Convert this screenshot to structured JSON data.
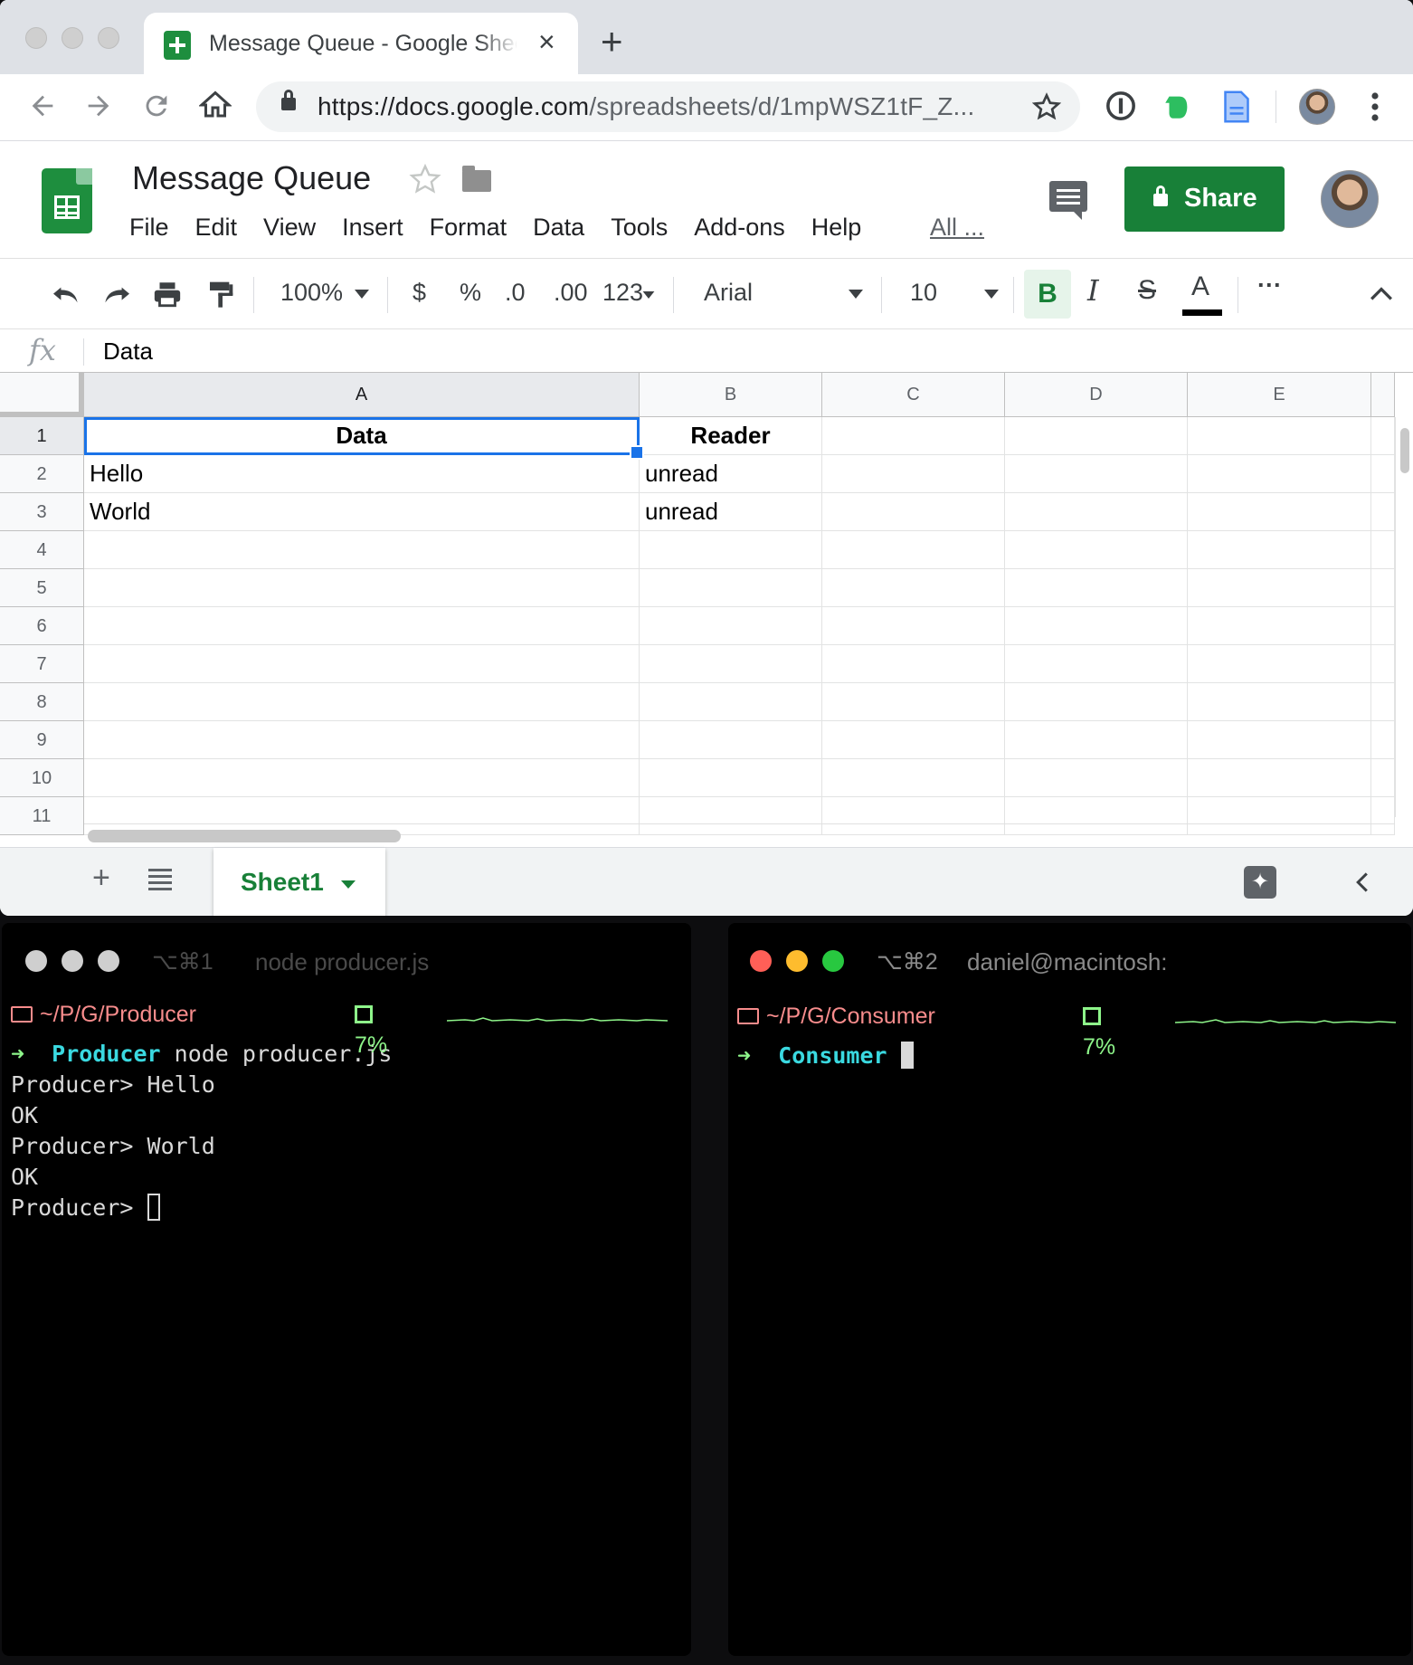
{
  "browser": {
    "tab_title": "Message Queue - Google Sheets",
    "tab_close": "×",
    "new_tab": "+",
    "url_host": "https://docs.google.com",
    "url_path": "/spreadsheets/d/1mpWSZ1tF_Z..."
  },
  "sheets": {
    "doc_title": "Message Queue",
    "menu": [
      "File",
      "Edit",
      "View",
      "Insert",
      "Format",
      "Data",
      "Tools",
      "Add-ons",
      "Help"
    ],
    "menu_all": "All ...",
    "share_label": "Share",
    "toolbar": {
      "zoom": "100%",
      "currency": "$",
      "percent": "%",
      "decrease_decimal": ".0",
      "increase_decimal": ".00",
      "more_formats": "123",
      "font": "Arial",
      "font_size": "10",
      "bold": "B",
      "italic": "I",
      "strikethrough": "S",
      "text_color": "A",
      "more": "···"
    },
    "formula_bar": {
      "fx": "fx",
      "value": "Data"
    },
    "columns": [
      "A",
      "B",
      "C",
      "D",
      "E"
    ],
    "rows": [
      "1",
      "2",
      "3",
      "4",
      "5",
      "6",
      "7",
      "8",
      "9",
      "10",
      "11"
    ],
    "cells": [
      [
        "Data",
        "Reader",
        "",
        "",
        ""
      ],
      [
        "Hello",
        "unread",
        "",
        "",
        ""
      ],
      [
        "World",
        "unread",
        "",
        "",
        ""
      ]
    ],
    "sheet_tab": "Sheet1",
    "add_sheet": "+"
  },
  "terminal_producer": {
    "shortcut": "⌥⌘1",
    "title": "node producer.js",
    "path": "~/P/G/Producer",
    "cpu": "7%",
    "prompt_dir": "Producer",
    "command": "node producer.js",
    "lines": [
      "Producer> Hello",
      "OK",
      "Producer> World",
      "OK"
    ],
    "current_prompt": "Producer>"
  },
  "terminal_consumer": {
    "shortcut": "⌥⌘2",
    "title": "daniel@macintosh:",
    "path": "~/P/G/Consumer",
    "cpu": "7%",
    "prompt_dir": "Consumer"
  },
  "colors": {
    "sheets_green": "#188038",
    "selection_blue": "#1a73e8",
    "terminal_path": "#f78c8c",
    "terminal_green": "#8ef58a",
    "terminal_cyan": "#3ad9e0"
  }
}
